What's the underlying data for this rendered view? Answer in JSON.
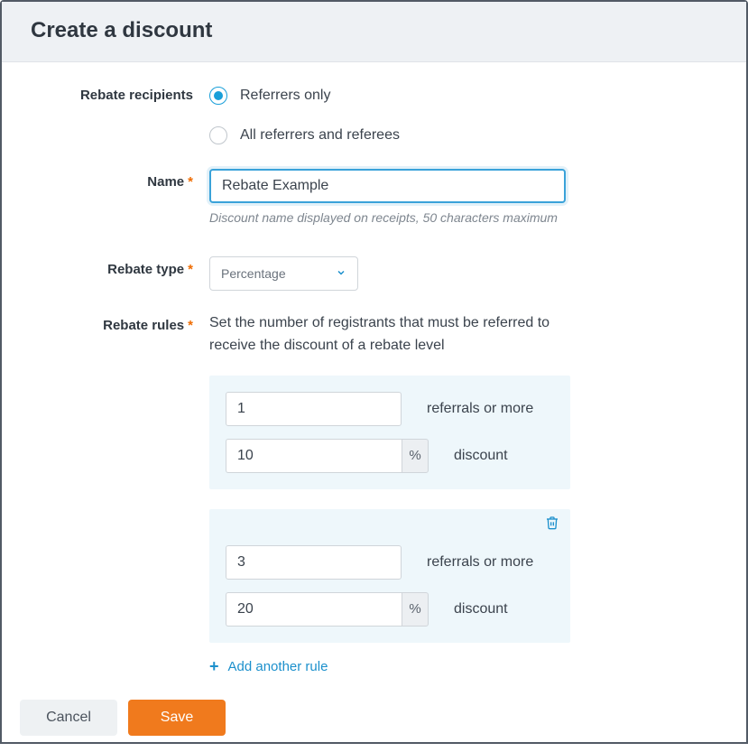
{
  "header": {
    "title": "Create a discount"
  },
  "labels": {
    "recipients": "Rebate recipients",
    "name": "Name",
    "rebate_type": "Rebate type",
    "rebate_rules": "Rebate rules",
    "required_marker": "*"
  },
  "recipients": {
    "options": [
      {
        "label": "Referrers only",
        "checked": true
      },
      {
        "label": "All referrers and referees",
        "checked": false
      }
    ]
  },
  "name_field": {
    "value": "Rebate Example",
    "hint": "Discount name displayed on receipts, 50 characters maximum"
  },
  "rebate_type": {
    "selected": "Percentage"
  },
  "rules": {
    "description": "Set the number of registrants that must be referred to receive the discount of a rebate level",
    "referrals_suffix": "referrals or more",
    "discount_suffix": "discount",
    "pct_symbol": "%",
    "items": [
      {
        "threshold": "1",
        "discount": "10",
        "deletable": false
      },
      {
        "threshold": "3",
        "discount": "20",
        "deletable": true
      }
    ],
    "add_label": "Add another rule"
  },
  "footer": {
    "cancel": "Cancel",
    "save": "Save"
  }
}
